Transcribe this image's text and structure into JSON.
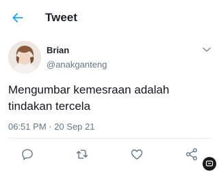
{
  "header": {
    "back_icon": "arrow-left-icon",
    "title": "Tweet"
  },
  "tweet": {
    "author_name": "Brian",
    "author_handle": "@anakganteng",
    "text": "Mengumbar kemesraan adalah tindakan tercela",
    "timestamp": "06:51 PM · 20 Sep 21"
  },
  "actions": [
    {
      "icon": "reply-icon"
    },
    {
      "icon": "retweet-icon"
    },
    {
      "icon": "heart-icon"
    },
    {
      "icon": "share-icon"
    }
  ],
  "colors": {
    "accent": "#1da1f2",
    "text": "#14171a",
    "secondary_text": "#657786",
    "divider": "#e6ecf0"
  }
}
